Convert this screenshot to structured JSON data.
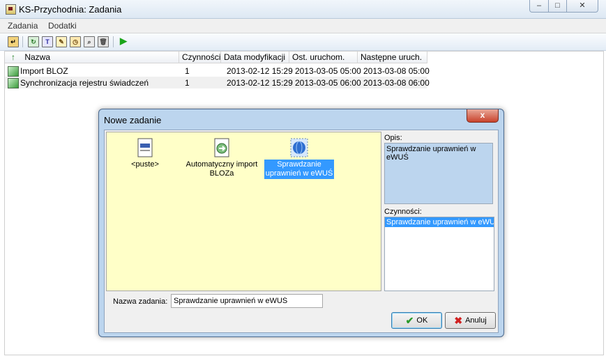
{
  "window": {
    "title": "KS-Przychodnia: Zadania",
    "min": "–",
    "max": "□",
    "close": "✕"
  },
  "menu": [
    {
      "label": "Zadania"
    },
    {
      "label": "Dodatki"
    }
  ],
  "toolbar": {
    "icons": [
      "exit-icon",
      "refresh-icon",
      "new-task-icon",
      "edit-icon",
      "schedule-icon",
      "preview-icon",
      "delete-icon",
      "run-icon"
    ]
  },
  "table": {
    "sort_indicator": "↑",
    "columns": [
      "Nazwa",
      "Czynności",
      "Data modyfikacji",
      "Ost. uruchom.",
      "Następne uruch."
    ],
    "rows": [
      {
        "name": "Import BLOZ",
        "count": "1",
        "modified": "2013-02-12 15:29",
        "last": "2013-03-05 05:00",
        "next": "2013-03-08 05:00"
      },
      {
        "name": "Synchronizacja rejestru świadczeń",
        "count": "1",
        "modified": "2013-02-12 15:29",
        "last": "2013-03-05 06:00",
        "next": "2013-03-08 06:00"
      }
    ]
  },
  "dialog": {
    "title": "Nowe zadanie",
    "close": "x",
    "templates": [
      {
        "label": "<puste>"
      },
      {
        "label": "Automatyczny import BLOZa"
      },
      {
        "label": "Sprawdzanie uprawnień w eWUŚ"
      }
    ],
    "opis_label": "Opis:",
    "opis_text": "Sprawdzanie uprawnień w eWUŚ",
    "czynnosci_label": "Czynności:",
    "czynnosci_items": [
      "Sprawdzanie uprawnień w eWUŚ"
    ],
    "name_label": "Nazwa zadania:",
    "name_value": "Sprawdzanie uprawnień w eWUŚ",
    "ok_label": "OK",
    "cancel_label": "Anuluj"
  },
  "colors": {
    "accent_selection": "#3399ff",
    "iconview_bg": "#ffffc8",
    "dialog_frame": "#bcd5ee"
  }
}
